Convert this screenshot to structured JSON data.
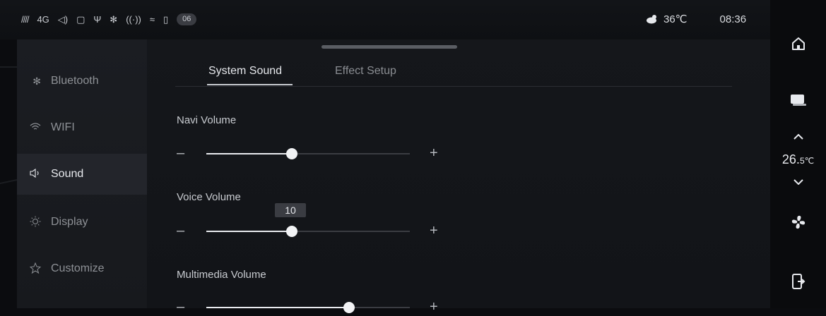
{
  "status": {
    "left": [
      "////",
      "4G",
      "◁)",
      "▢",
      "Ψ",
      "✻",
      "((·))",
      "≈",
      "▯"
    ],
    "badge": "06",
    "weather_temp": "36℃",
    "time": "08:36"
  },
  "sidebar": {
    "items": [
      {
        "label": "Bluetooth",
        "icon": "bluetooth-icon",
        "active": false
      },
      {
        "label": "WIFI",
        "icon": "wifi-icon",
        "active": false
      },
      {
        "label": "Sound",
        "icon": "speaker-icon",
        "active": true
      },
      {
        "label": "Display",
        "icon": "sun-icon",
        "active": false
      },
      {
        "label": "Customize",
        "icon": "customize-icon",
        "active": false
      }
    ]
  },
  "tabs": {
    "system_sound": "System Sound",
    "effect_setup": "Effect Setup"
  },
  "volumes": [
    {
      "label": "Navi Volume",
      "level": 0.42
    },
    {
      "label": "Voice Volume",
      "level": 0.42,
      "tooltip": "10"
    },
    {
      "label": "Multimedia Volume",
      "level": 0.7
    }
  ],
  "controls": {
    "minus": "–",
    "plus": "+"
  },
  "dock": {
    "temp_value": "26.",
    "temp_decimal": "5℃"
  }
}
